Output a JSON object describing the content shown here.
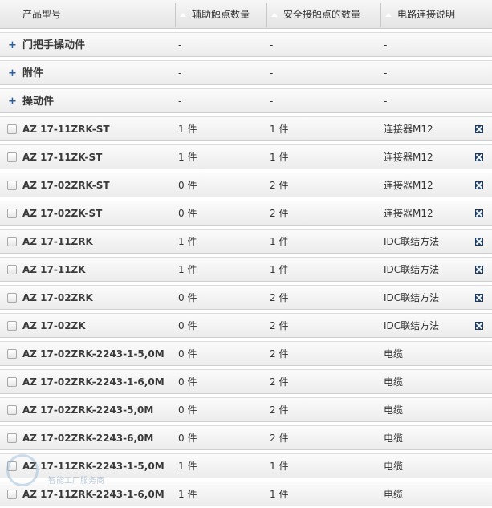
{
  "header": {
    "col_name": "产品型号",
    "col_aux": "辅助触点数量",
    "col_safe": "安全接触点的数量",
    "col_conn": "电路连接说明"
  },
  "groups": [
    {
      "expand": "+",
      "name": "门把手操动件",
      "aux": "-",
      "safe": "-",
      "conn": "-"
    },
    {
      "expand": "+",
      "name": "附件",
      "aux": "-",
      "safe": "-",
      "conn": "-"
    },
    {
      "expand": "+",
      "name": "操动件",
      "aux": "-",
      "safe": "-",
      "conn": "-"
    }
  ],
  "rows": [
    {
      "name": "AZ 17-11ZRK-ST",
      "aux": "1 件",
      "safe": "1 件",
      "conn": "连接器M12",
      "icon": "close-icon"
    },
    {
      "name": "AZ 17-11ZK-ST",
      "aux": "1 件",
      "safe": "1 件",
      "conn": "连接器M12",
      "icon": "close-icon"
    },
    {
      "name": "AZ 17-02ZRK-ST",
      "aux": "0 件",
      "safe": "2 件",
      "conn": "连接器M12",
      "icon": "close-icon"
    },
    {
      "name": "AZ 17-02ZK-ST",
      "aux": "0 件",
      "safe": "2 件",
      "conn": "连接器M12",
      "icon": "close-icon"
    },
    {
      "name": "AZ 17-11ZRK",
      "aux": "1 件",
      "safe": "1 件",
      "conn": "IDC联结方法",
      "icon": "close-icon"
    },
    {
      "name": "AZ 17-11ZK",
      "aux": "1 件",
      "safe": "1 件",
      "conn": "IDC联结方法",
      "icon": "close-icon"
    },
    {
      "name": "AZ 17-02ZRK",
      "aux": "0 件",
      "safe": "2 件",
      "conn": "IDC联结方法",
      "icon": "close-icon"
    },
    {
      "name": "AZ 17-02ZK",
      "aux": "0 件",
      "safe": "2 件",
      "conn": "IDC联结方法",
      "icon": "close-icon"
    },
    {
      "name": "AZ 17-02ZRK-2243-1-5,0M",
      "aux": "0 件",
      "safe": "2 件",
      "conn": "电缆"
    },
    {
      "name": "AZ 17-02ZRK-2243-1-6,0M",
      "aux": "0 件",
      "safe": "2 件",
      "conn": "电缆"
    },
    {
      "name": "AZ 17-02ZRK-2243-5,0M",
      "aux": "0 件",
      "safe": "2 件",
      "conn": "电缆"
    },
    {
      "name": "AZ 17-02ZRK-2243-6,0M",
      "aux": "0 件",
      "safe": "2 件",
      "conn": "电缆"
    },
    {
      "name": "AZ 17-11ZRK-2243-1-5,0M",
      "aux": "1 件",
      "safe": "1 件",
      "conn": "电缆"
    },
    {
      "name": "AZ 17-11ZRK-2243-1-6,0M",
      "aux": "1 件",
      "safe": "1 件",
      "conn": "电缆"
    }
  ],
  "watermark": {
    "text": "智能工厂服务商"
  }
}
